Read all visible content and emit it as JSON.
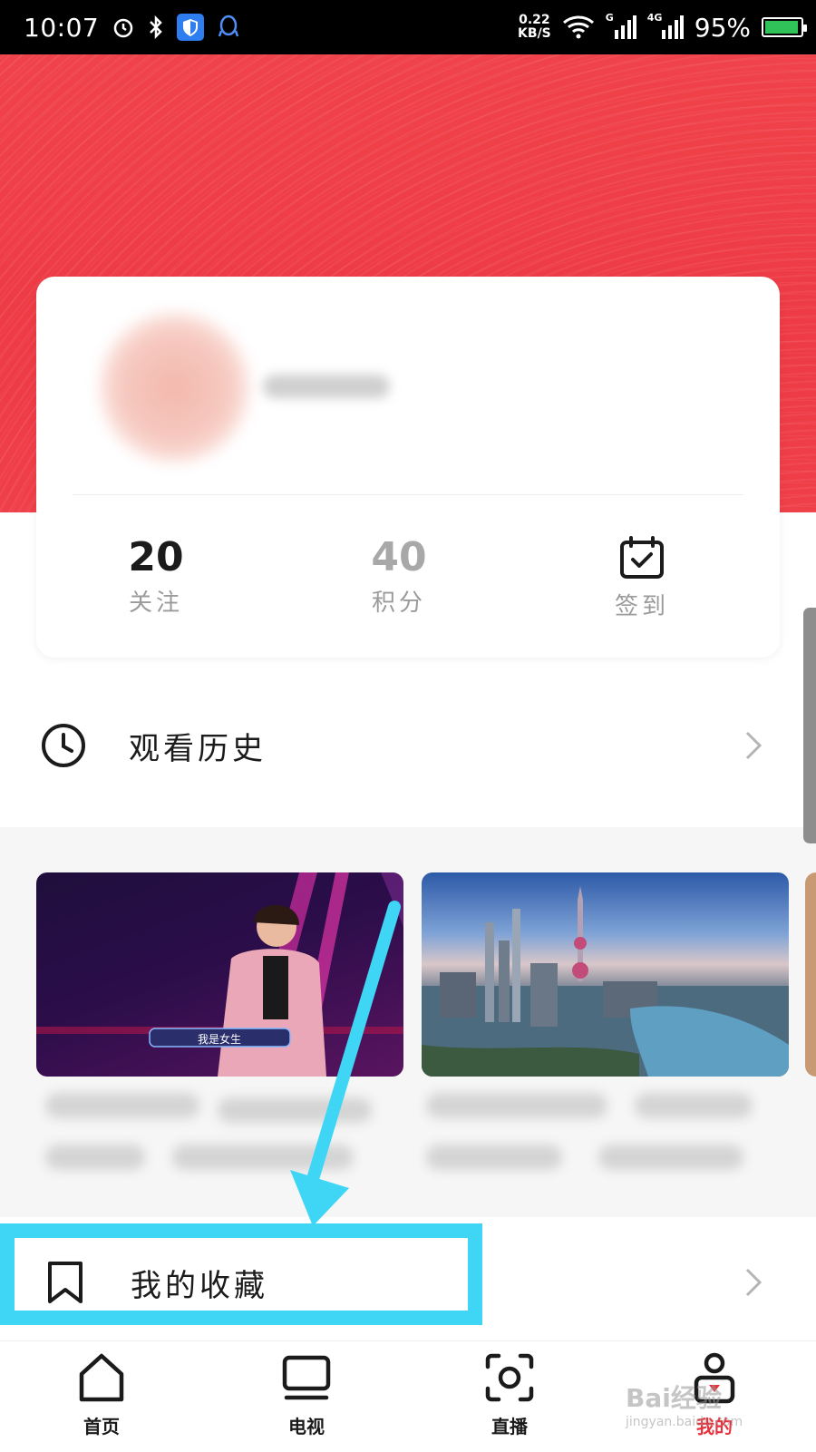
{
  "status_bar": {
    "time": "10:07",
    "network_speed_value": "0.22",
    "network_speed_unit": "KB/S",
    "signal_1_label": "G",
    "signal_2_label": "4G",
    "battery_percent": "95%",
    "battery_level": 0.95
  },
  "profile": {
    "stats": [
      {
        "value": "20",
        "label": "关注"
      },
      {
        "value": "40",
        "label": "积分"
      },
      {
        "value": "",
        "label": "签到"
      }
    ]
  },
  "menu": {
    "history_label": "观看历史",
    "favorites_label": "我的收藏"
  },
  "thumbnails": [
    {
      "caption": "我是女生"
    },
    {
      "caption": ""
    }
  ],
  "bottom_nav": {
    "items": [
      {
        "label": "首页"
      },
      {
        "label": "电视"
      },
      {
        "label": "直播"
      },
      {
        "label": "我的"
      }
    ]
  },
  "watermark": {
    "text": "Bai经验",
    "sub": "jingyan.baidu.com"
  },
  "colors": {
    "accent": "#e8333e",
    "header_red": "#ef3f49",
    "highlight": "#3ed6f4"
  }
}
